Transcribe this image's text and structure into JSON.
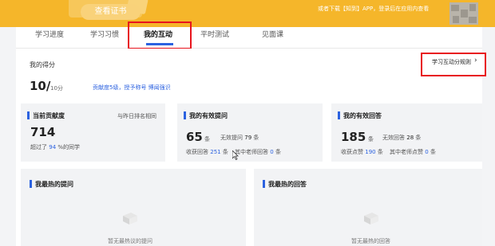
{
  "banner": {
    "view_cert": "查看证书",
    "app_hint": "或者下载【知到】APP，登录后在应用内查看"
  },
  "tabs": [
    {
      "label": "学习进度"
    },
    {
      "label": "学习习惯"
    },
    {
      "label": "我的互动"
    },
    {
      "label": "平时测试"
    },
    {
      "label": "见面课"
    }
  ],
  "score": {
    "title": "我的得分",
    "value": "10/",
    "unit": "10分",
    "hint": "贡献度5级，授予称号 博闻强识"
  },
  "rules_link": "学习互动分规则",
  "contribution": {
    "title": "当前贡献度",
    "rank_note": "与昨日排名相同",
    "value": "714",
    "exceed_prefix": "超过了",
    "exceed_value": "94",
    "exceed_suffix": "%的同学"
  },
  "questions": {
    "title": "我的有效提问",
    "value": "65",
    "unit": "条",
    "invalid_label": "无效提问",
    "invalid_value": "79",
    "invalid_unit": "条",
    "received_label": "收获回答",
    "received_value": "251",
    "received_unit": "条",
    "teacher_label": "其中老师回答",
    "teacher_value": "0",
    "teacher_unit": "条"
  },
  "answers": {
    "title": "我的有效回答",
    "value": "185",
    "unit": "条",
    "invalid_label": "无效回答",
    "invalid_value": "28",
    "invalid_unit": "条",
    "likes_label": "收获点赞",
    "likes_value": "190",
    "likes_unit": "条",
    "teacher_label": "其中老师点赞",
    "teacher_value": "0",
    "teacher_unit": "条"
  },
  "hot_questions": {
    "title": "我最热的提问",
    "empty": "暂无最热议的提问"
  },
  "hot_answers": {
    "title": "我最热的回答",
    "empty": "暂无最热的回答"
  },
  "colors": {
    "accent": "#2c62e0",
    "banner": "#f5b62a",
    "highlight": "#e8141d"
  }
}
